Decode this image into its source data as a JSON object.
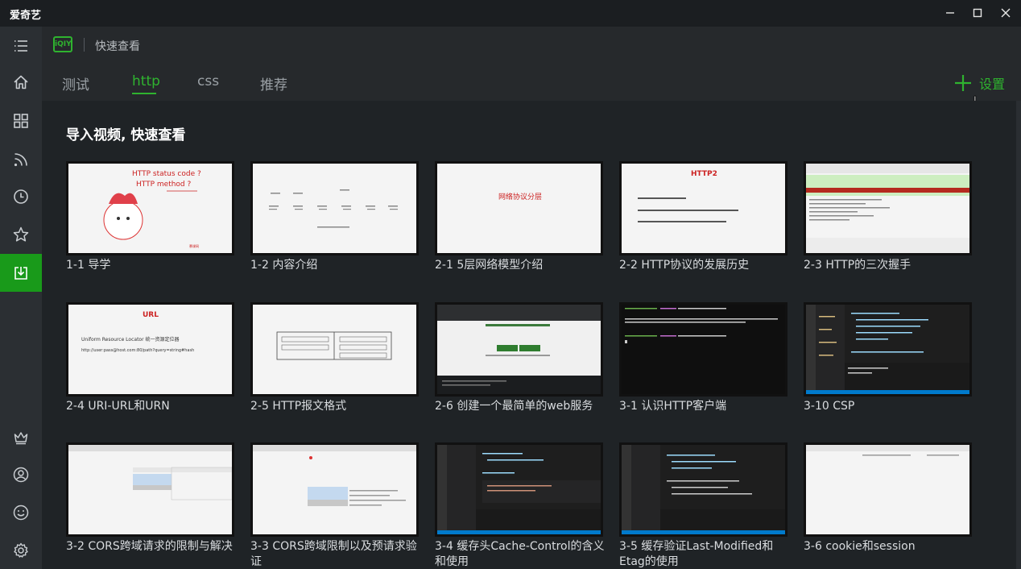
{
  "app": {
    "title": "爱奇艺"
  },
  "window": {
    "minimize_icon": "minimize-icon",
    "maximize_icon": "maximize-icon",
    "close_icon": "close-icon"
  },
  "header": {
    "title": "快速查看",
    "logo_text": "iQIY",
    "tabs": [
      {
        "label": "测试",
        "active": false
      },
      {
        "label": "http",
        "active": true
      },
      {
        "label": "css",
        "active": false
      },
      {
        "label": "推荐",
        "active": false
      }
    ],
    "settings_label": "设置"
  },
  "sidebar": {
    "items": [
      {
        "icon": "menu-icon"
      },
      {
        "icon": "home-icon"
      },
      {
        "icon": "grid-icon"
      },
      {
        "icon": "rss-icon"
      },
      {
        "icon": "clock-icon"
      },
      {
        "icon": "star-icon"
      },
      {
        "icon": "download-icon",
        "active": true
      },
      {
        "icon": "crown-icon"
      },
      {
        "icon": "user-icon"
      },
      {
        "icon": "smile-icon"
      },
      {
        "icon": "gear-icon"
      }
    ]
  },
  "section": {
    "title": "导入视频, 快速查看"
  },
  "thumb_text": {
    "t1_line1": "HTTP status code ?",
    "t1_line2": "HTTP method ?",
    "t3_title": "网络协议分层",
    "t4_title": "HTTP2",
    "t6_title": "URL",
    "t6_line1": "Uniform Resource Locator 统一资源定位器",
    "t6_line2": "http://user:pass@host.com:80/path?query=string#hash"
  },
  "videos": [
    {
      "title": "1-1 导学",
      "thumb": "light"
    },
    {
      "title": "1-2 内容介绍",
      "thumb": "light"
    },
    {
      "title": "2-1 5层网络模型介绍",
      "thumb": "light"
    },
    {
      "title": "2-2 HTTP协议的发展历史",
      "thumb": "light"
    },
    {
      "title": "2-3 HTTP的三次握手",
      "thumb": "light"
    },
    {
      "title": "2-4 URI-URL和URN",
      "thumb": "light"
    },
    {
      "title": "2-5 HTTP报文格式",
      "thumb": "light"
    },
    {
      "title": "2-6 创建一个最简单的web服务",
      "thumb": "dark"
    },
    {
      "title": "3-1 认识HTTP客户端",
      "thumb": "dark"
    },
    {
      "title": "3-10 CSP",
      "thumb": "code"
    },
    {
      "title": "3-2 CORS跨域请求的限制与解决",
      "thumb": "light"
    },
    {
      "title": "3-3 CORS跨域限制以及预请求验证",
      "thumb": "light"
    },
    {
      "title": "3-4 缓存头Cache-Control的含义和使用",
      "thumb": "code"
    },
    {
      "title": "3-5 缓存验证Last-Modified和Etag的使用",
      "thumb": "code"
    },
    {
      "title": "3-6 cookie和session",
      "thumb": "light"
    }
  ],
  "colors": {
    "accent": "#2fb32f",
    "active_sidebar": "#199a1a",
    "background": "#1f2326"
  }
}
